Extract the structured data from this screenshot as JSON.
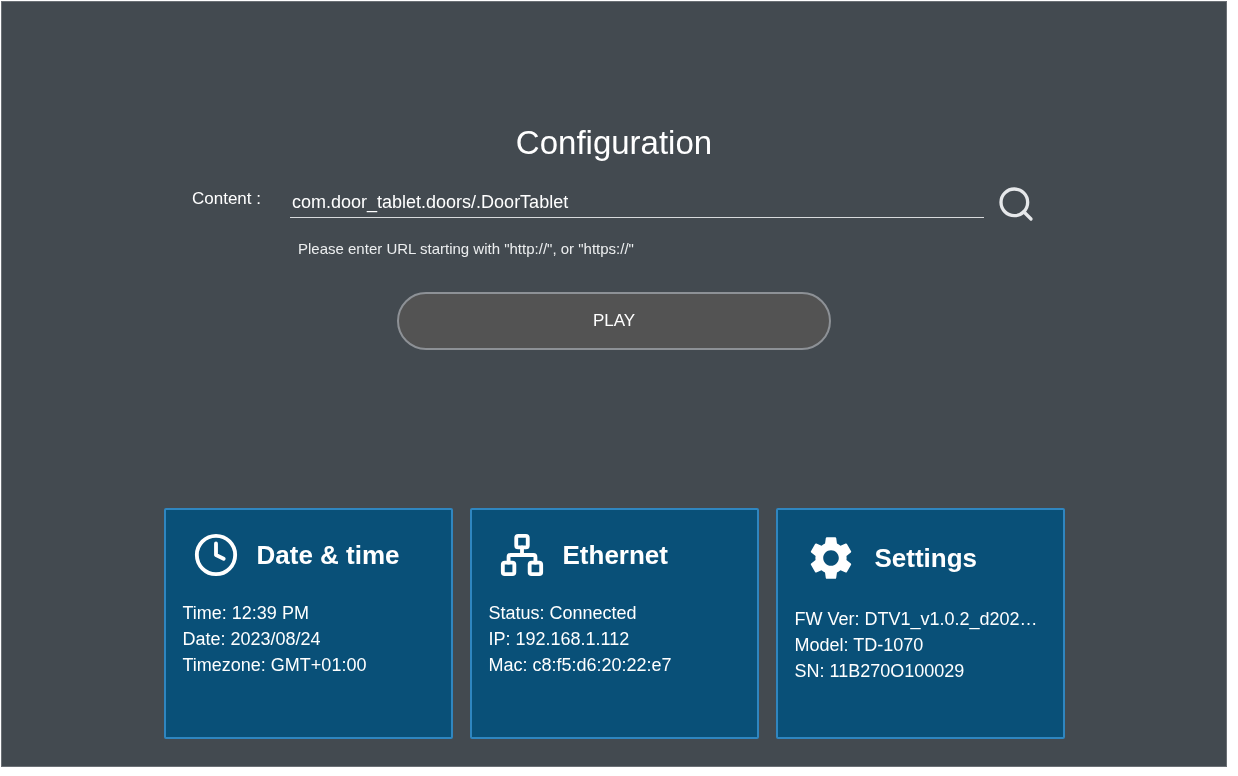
{
  "title": "Configuration",
  "content_field": {
    "label": "Content :",
    "value": "com.door_tablet.doors/.DoorTablet",
    "hint": "Please enter URL starting with \"http://\", or \"https://\""
  },
  "play_button": "PLAY",
  "cards": [
    {
      "kind": "clock",
      "title": "Date & time",
      "lines": [
        "Time: 12:39 PM",
        "Date: 2023/08/24",
        "Timezone: GMT+01:00"
      ]
    },
    {
      "kind": "network",
      "title": "Ethernet",
      "lines": [
        "Status: Connected",
        "IP: 192.168.1.112",
        "Mac: c8:f5:d6:20:22:e7"
      ]
    },
    {
      "kind": "gear",
      "title": "Settings",
      "lines": [
        "FW Ver: DTV1_v1.0.2_d202…",
        "Model: TD-1070",
        "SN: 11B270O100029"
      ]
    }
  ]
}
